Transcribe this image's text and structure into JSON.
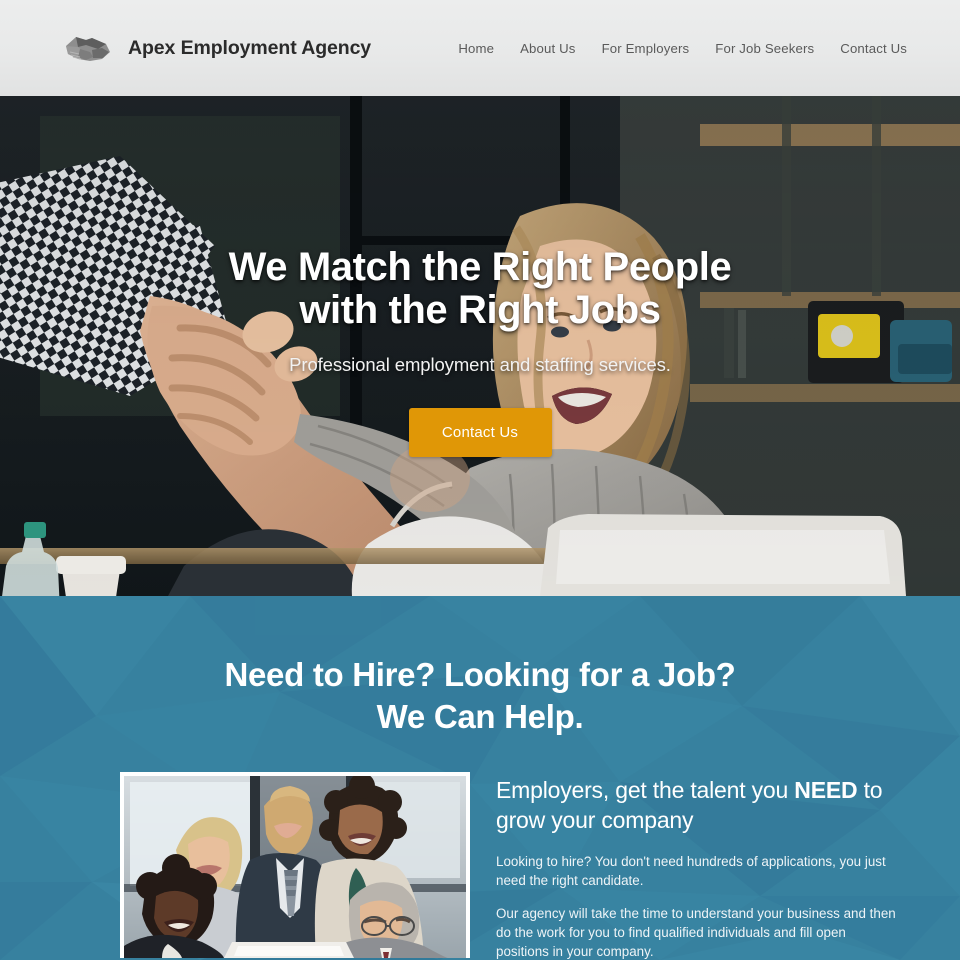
{
  "header": {
    "logo_icon": "handshake-icon",
    "brand_name": "Apex Employment Agency",
    "nav": [
      {
        "label": "Home"
      },
      {
        "label": "About Us"
      },
      {
        "label": "For Employers"
      },
      {
        "label": "For Job Seekers"
      },
      {
        "label": "Contact Us"
      }
    ]
  },
  "hero": {
    "title_line1": "We Match the Right People",
    "title_line2": "with the Right Jobs",
    "subtitle": "Professional employment and staffing services.",
    "cta_label": "Contact Us",
    "cta_color": "#e09706",
    "image_alt": "handshake-over-desk-photo"
  },
  "blue_section": {
    "bg_color": "#37819f",
    "heading_line1": "Need to Hire? Looking for a Job?",
    "heading_line2": "We Can Help.",
    "photo_alt": "business-team-photo",
    "column_heading_part1": "Employers, get the talent you ",
    "column_heading_emphasis": "NEED",
    "column_heading_part2": " to grow your company",
    "paragraph1": "Looking to hire? You don't need hundreds of applications, you just need the right candidate.",
    "paragraph2": "Our agency will take the time to understand your business and then do the work for you to find qualified individuals and fill open positions in your company."
  }
}
